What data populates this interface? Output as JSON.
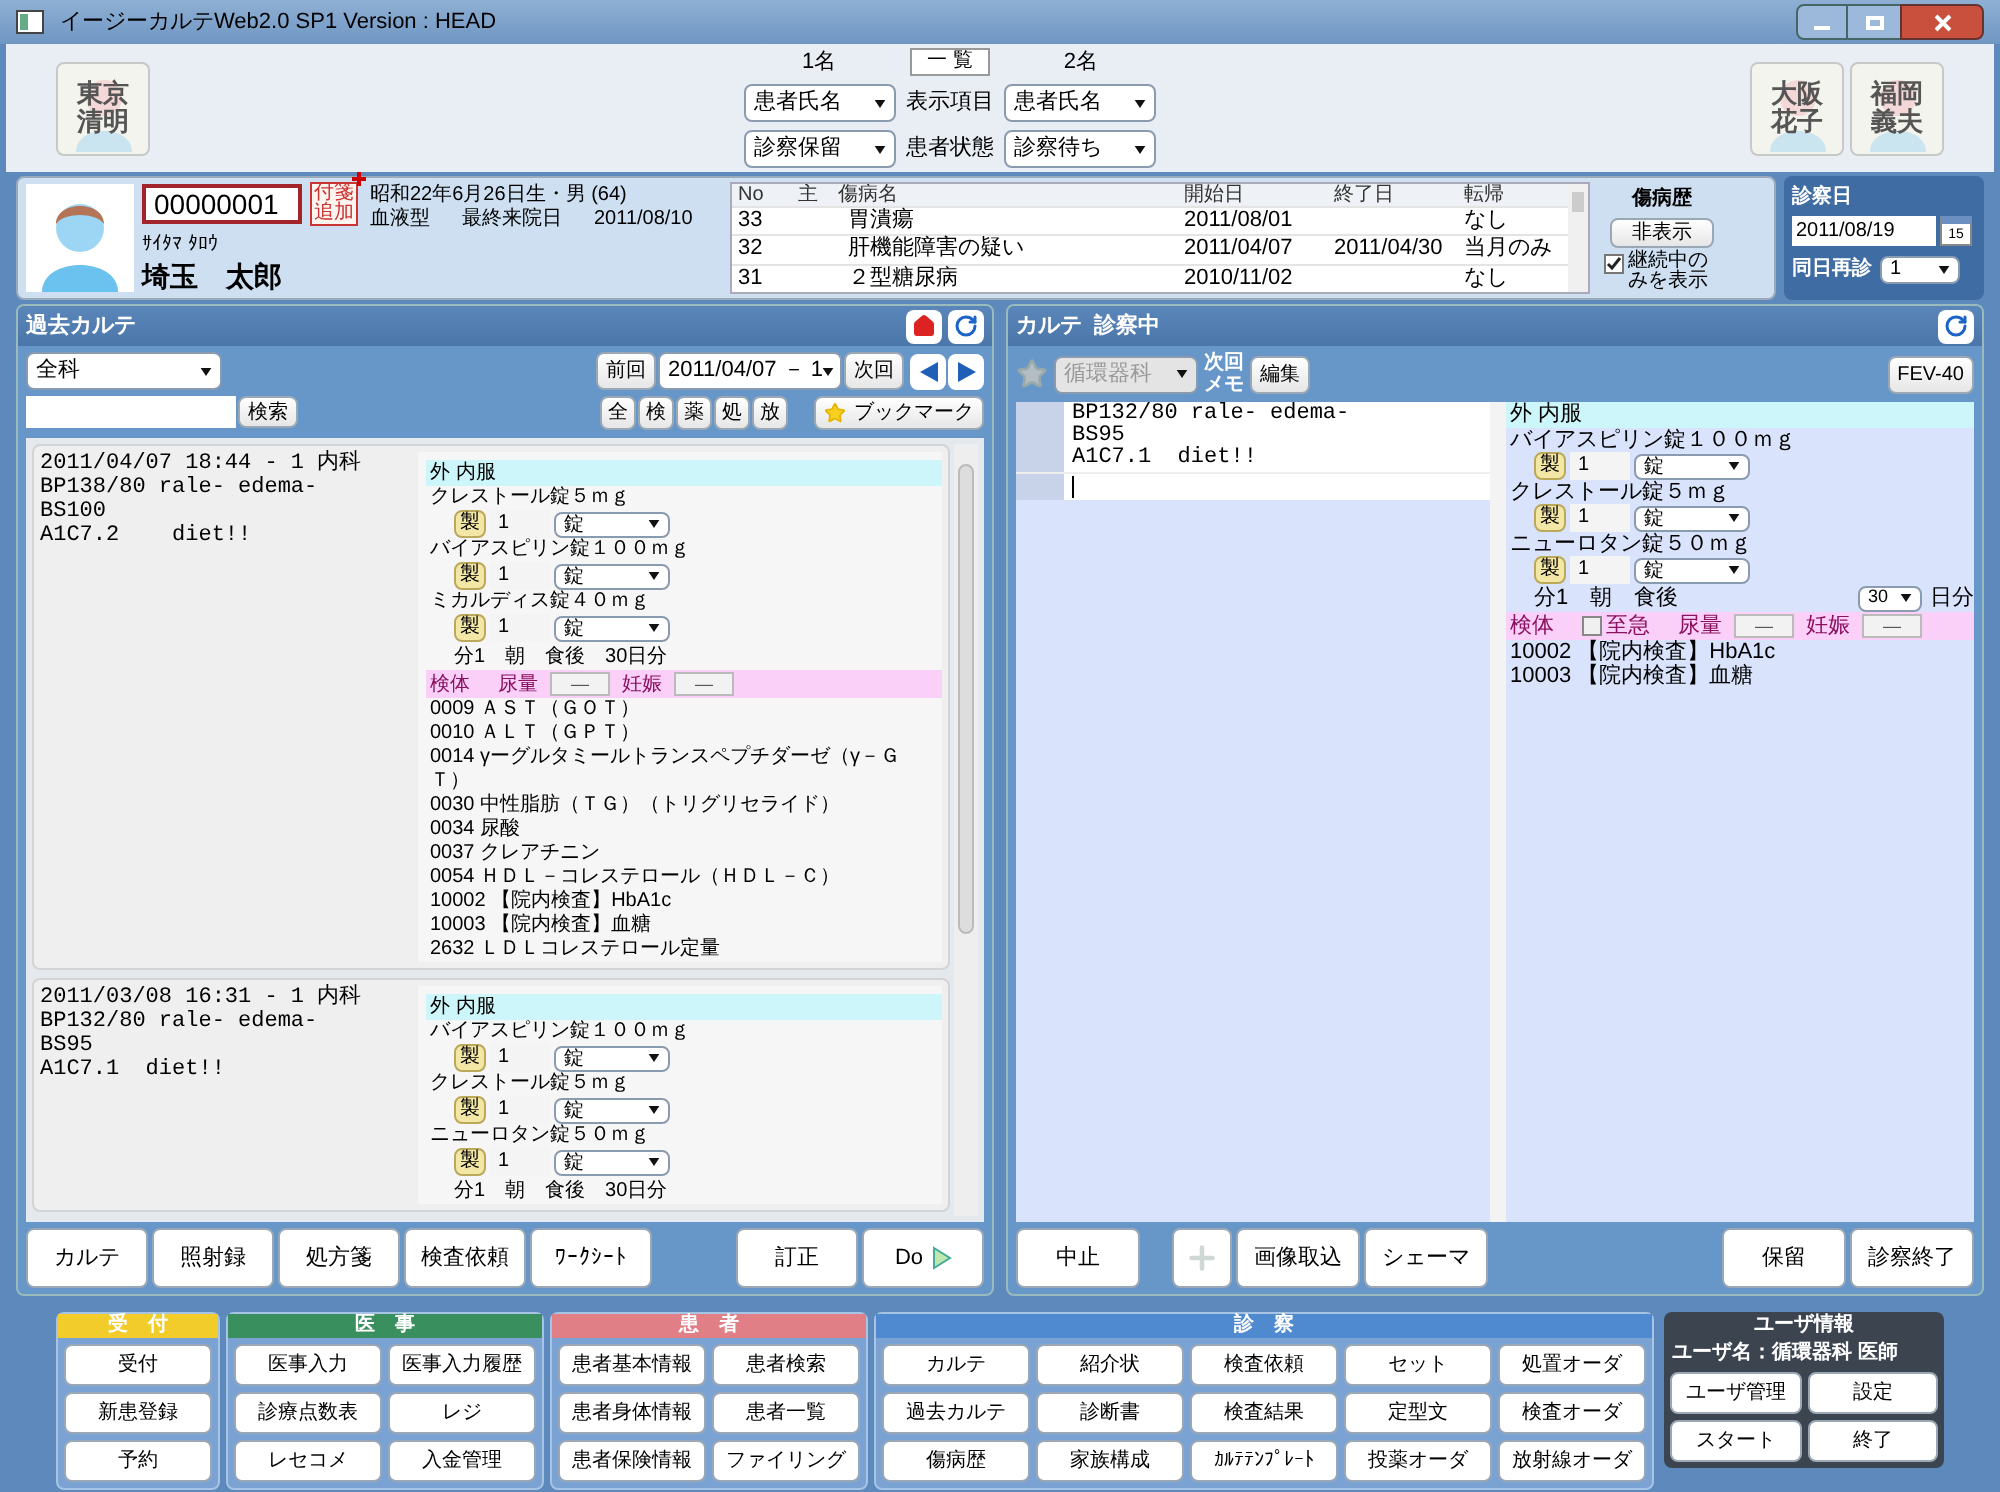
{
  "window": {
    "title": "イージーカルテWeb2.0 SP1 Version : HEAD"
  },
  "header": {
    "doctors_left": [
      {
        "lines": [
          "東京",
          "清明"
        ]
      }
    ],
    "doctors_right": [
      {
        "lines": [
          "大阪",
          "花子"
        ]
      },
      {
        "lines": [
          "福岡",
          "義夫"
        ]
      }
    ],
    "slot1_label": "1名",
    "list_button": "一 覧",
    "slot2_label": "2名",
    "rows": [
      {
        "left": "患者氏名",
        "label": "表示項目",
        "right": "患者氏名"
      },
      {
        "left": "診察保留",
        "label": "患者状態",
        "right": "診察待ち"
      }
    ]
  },
  "patient": {
    "id": "00000001",
    "sticky_note": [
      "付箋",
      "追加"
    ],
    "birth": "昭和22年6月26日生・男 (64)",
    "blood_type_label": "血液型",
    "last_visit_label": "最終来院日",
    "last_visit": "2011/08/10",
    "kana": "ｻｲﾀﾏ ﾀﾛｳ",
    "name": "埼玉　太郎"
  },
  "diseases": {
    "columns": [
      "No",
      "主",
      "傷病名",
      "開始日",
      "終了日",
      "転帰"
    ],
    "rows": [
      {
        "no": "33",
        "name": "胃潰瘍",
        "start": "2011/08/01",
        "outcome": "なし"
      },
      {
        "no": "32",
        "name": "肝機能障害の疑い",
        "start": "2011/04/07",
        "end": "2011/04/30",
        "outcome": "当月のみ"
      },
      {
        "no": "31",
        "name": "２型糖尿病",
        "start": "2010/11/02",
        "outcome": "なし"
      }
    ]
  },
  "disease_history": {
    "title": "傷病歴",
    "hide_button": "非表示",
    "ongoing_only": {
      "label": "継続中のみを表示",
      "checked": true
    }
  },
  "exam_date": {
    "title": "診察日",
    "date": "2011/08/19",
    "calendar_day": "15",
    "revisit_label": "同日再診",
    "revisit": "1"
  },
  "past_chart": {
    "title": "過去カルテ",
    "department": "全科",
    "search_button": "検索",
    "prev": "前回",
    "date": "2011/04/07 － 1",
    "next": "次回",
    "filters": [
      "全",
      "検",
      "薬",
      "処",
      "放"
    ],
    "bookmark": "ブックマーク",
    "records": [
      {
        "header": "2011/04/07 18:44 - 1 内科",
        "notes": [
          "BP138/80 rale- edema-",
          "BS100",
          "A1C7.2    diet!!"
        ],
        "orders": [
          {
            "kind": "section",
            "label": "外 内服"
          },
          {
            "kind": "drug",
            "name": "クレストール錠５ｍｇ",
            "badge": "製",
            "qty": "1",
            "unit": "錠"
          },
          {
            "kind": "drug",
            "name": "バイアスピリン錠１００ｍｇ",
            "badge": "製",
            "qty": "1",
            "unit": "錠"
          },
          {
            "kind": "drug",
            "name": "ミカルディス錠４０ｍｇ",
            "badge": "製",
            "qty": "1",
            "unit": "錠"
          },
          {
            "kind": "usage",
            "text": "分1　朝　食後　30日分"
          },
          {
            "kind": "specimen",
            "label": "検体",
            "urine": "尿量",
            "urine_value": "—",
            "pregnancy": "妊娠",
            "pregnancy_value": "—"
          },
          {
            "kind": "item",
            "text": "0009 ＡＳＴ（ＧＯＴ）"
          },
          {
            "kind": "item",
            "text": "0010 ＡＬＴ（ＧＰＴ）"
          },
          {
            "kind": "item",
            "text": "0014 γーグルタミールトランスペプチダーゼ（γ－ＧＴ）"
          },
          {
            "kind": "item",
            "text": "0030 中性脂肪（ＴＧ）（トリグリセライド）"
          },
          {
            "kind": "item",
            "text": "0034 尿酸"
          },
          {
            "kind": "item",
            "text": "0037 クレアチニン"
          },
          {
            "kind": "item",
            "text": "0054 ＨＤＬ－コレステロール（ＨＤＬ－Ｃ）"
          },
          {
            "kind": "item",
            "text": "10002 【院内検査】HbA1c"
          },
          {
            "kind": "item",
            "text": "10003 【院内検査】血糖"
          },
          {
            "kind": "item",
            "text": "2632 ＬＤＬコレステロール定量"
          }
        ]
      },
      {
        "header": "2011/03/08 16:31 - 1 内科",
        "notes": [
          "BP132/80 rale- edema-",
          "BS95",
          "A1C7.1  diet!!"
        ],
        "orders": [
          {
            "kind": "section",
            "label": "外 内服"
          },
          {
            "kind": "drug",
            "name": "バイアスピリン錠１００ｍｇ",
            "badge": "製",
            "qty": "1",
            "unit": "錠"
          },
          {
            "kind": "drug",
            "name": "クレストール錠５ｍｇ",
            "badge": "製",
            "qty": "1",
            "unit": "錠"
          },
          {
            "kind": "drug",
            "name": "ニューロタン錠５０ｍｇ",
            "badge": "製",
            "qty": "1",
            "unit": "錠"
          },
          {
            "kind": "usage",
            "text": "分1　朝　食後　30日分"
          }
        ]
      }
    ],
    "buttons_left": [
      {
        "kind": "plain",
        "label": "カルテ"
      },
      {
        "kind": "plain",
        "label": "照射録"
      },
      {
        "kind": "plain",
        "label": "処方箋"
      },
      {
        "kind": "plain",
        "label": "検査依頼"
      },
      {
        "kind": "plain",
        "label": "ﾜｰｸｼｰﾄ"
      }
    ],
    "buttons_right": [
      {
        "kind": "plain",
        "label": "訂正"
      },
      {
        "kind": "next",
        "label": "Do"
      }
    ]
  },
  "current_chart": {
    "title": "カルテ  診察中",
    "department": "循環器科",
    "memo_label": [
      "次回",
      "メモ"
    ],
    "edit_button": "編集",
    "fev_button": "FEV-40",
    "notes": [
      "BP132/80 rale- edema-",
      "BS95",
      "A1C7.1  diet!!"
    ],
    "orders": [
      {
        "kind": "section",
        "label": "外 内服"
      },
      {
        "kind": "drug",
        "name": "バイアスピリン錠１００ｍｇ",
        "badge": "製",
        "qty": "1",
        "unit": "錠"
      },
      {
        "kind": "drug",
        "name": "クレストール錠５ｍｇ",
        "badge": "製",
        "qty": "1",
        "unit": "錠"
      },
      {
        "kind": "drug",
        "name": "ニューロタン錠５０ｍｇ",
        "badge": "製",
        "qty": "1",
        "unit": "錠"
      },
      {
        "kind": "usage",
        "text": "分1　朝　食後",
        "days": "30",
        "days_unit": "日分"
      },
      {
        "kind": "specimen",
        "label": "検体",
        "urgent": {
          "label": "至急",
          "checked": false
        },
        "urine": "尿量",
        "urine_value": "—",
        "pregnancy": "妊娠",
        "pregnancy_value": "—"
      },
      {
        "kind": "item",
        "text": "10002 【院内検査】HbA1c"
      },
      {
        "kind": "item",
        "text": "10003 【院内検査】血糖"
      }
    ],
    "buttons_left": [
      {
        "kind": "plain",
        "label": "中止",
        "disabled": false
      }
    ],
    "buttons_middle": [
      {
        "kind": "add",
        "disabled": true
      },
      {
        "kind": "plain",
        "label": "画像取込",
        "disabled": false
      },
      {
        "kind": "plain",
        "label": "シェーマ",
        "disabled": false
      }
    ],
    "buttons_right": [
      {
        "kind": "plain",
        "label": "保留",
        "disabled": false
      },
      {
        "kind": "plain",
        "label": "診察終了",
        "disabled": false
      }
    ]
  },
  "menu": {
    "groups": [
      {
        "title": "受　付",
        "color": "#f2cc2a",
        "items": [
          "受付",
          "新患登録",
          "予約"
        ]
      },
      {
        "title": "医　事",
        "color": "#3a8f5e",
        "items": [
          "医事入力",
          "医事入力履歴",
          "診療点数表",
          "レジ",
          "レセコメ",
          "入金管理"
        ]
      },
      {
        "title": "患　者",
        "color": "#e07f86",
        "items": [
          "患者基本情報",
          "患者検索",
          "患者身体情報",
          "患者一覧",
          "患者保険情報",
          "ファイリング"
        ]
      },
      {
        "title": "診　察",
        "color": "#4f8ad0",
        "items": [
          "カルテ",
          "紹介状",
          "検査依頼",
          "セット",
          "処置オーダ",
          "過去カルテ",
          "診断書",
          "検査結果",
          "定型文",
          "検査オーダ",
          "傷病歴",
          "家族構成",
          "ｶﾙﾃﾃﾝﾌﾟﾚｰﾄ",
          "投薬オーダ",
          "放射線オーダ"
        ]
      }
    ],
    "user": {
      "title": "ユーザ情報",
      "user_line": "ユーザ名：循環器科 医師",
      "items": [
        "ユーザ管理",
        "設定",
        "スタート",
        "終了"
      ]
    }
  }
}
